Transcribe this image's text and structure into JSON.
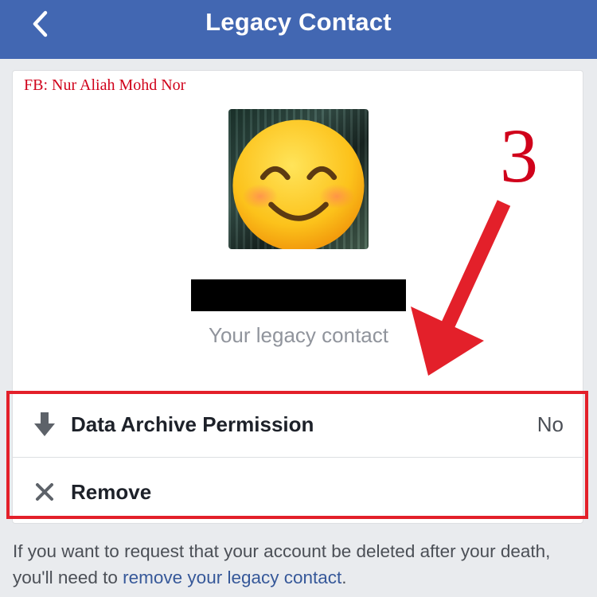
{
  "nav": {
    "title": "Legacy Contact",
    "back_icon": "chevron-left-icon"
  },
  "watermark": "FB: Nur Aliah Mohd Nor",
  "profile": {
    "subtitle": "Your legacy contact",
    "avatar_icon": "smiling-face-emoji"
  },
  "rows": [
    {
      "icon": "arrow-down-icon",
      "label": "Data Archive Permission",
      "value": "No"
    },
    {
      "icon": "close-icon",
      "label": "Remove"
    }
  ],
  "annotation": {
    "number": "3",
    "color": "#d0021b"
  },
  "footer": {
    "text_before": "If you want to request that your account be deleted after your death, you'll need to ",
    "link": "remove your legacy contact",
    "text_after": "."
  },
  "colors": {
    "header": "#4267b2",
    "link": "#365899",
    "annotation": "#e3202a"
  }
}
